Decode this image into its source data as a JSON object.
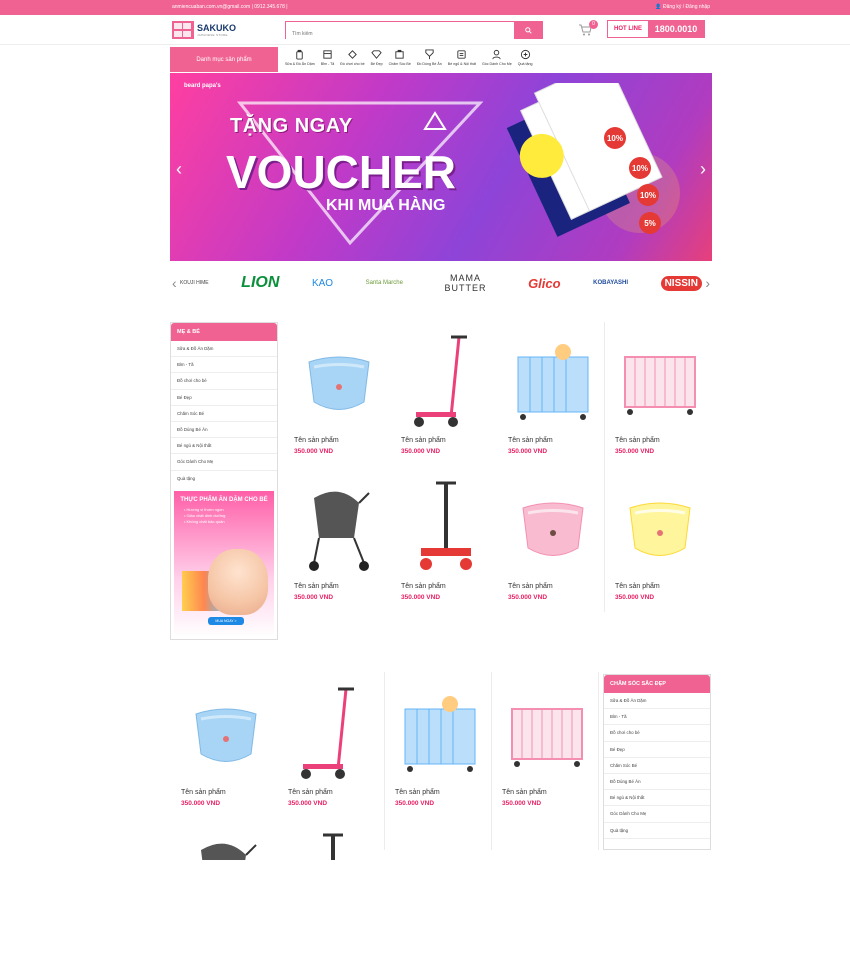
{
  "topbar": {
    "email": "anmiencuaban.com.vn@gmail.com",
    "phone": "0912.345.678",
    "auth": "Đăng ký / Đăng nhập"
  },
  "logo": {
    "brand": "SAKUKO",
    "sub": "JAPANESE STORE"
  },
  "search": {
    "placeholder": "Tìm kiếm"
  },
  "cart": {
    "count": "0"
  },
  "hotline": {
    "label": "HOT LINE",
    "number": "1800.0010"
  },
  "nav": {
    "category_label": "Danh mục sản phẩm",
    "items": [
      {
        "label": "Sữa & Đồ Ăn Dặm",
        "icon": "bottle-icon"
      },
      {
        "label": "Bỉm - Tã",
        "icon": "diaper-icon"
      },
      {
        "label": "Đồ chơi cho bé",
        "icon": "toy-icon"
      },
      {
        "label": "Bé Đẹp",
        "icon": "diamond-icon"
      },
      {
        "label": "Chăm Sóc Bé",
        "icon": "care-icon"
      },
      {
        "label": "Đồ Dùng Bé Ăn",
        "icon": "dish-icon"
      },
      {
        "label": "Bé ngủ & Nội thất",
        "icon": "bed-icon"
      },
      {
        "label": "Góc Dành Cho Mẹ",
        "icon": "mom-icon"
      },
      {
        "label": "Quà tặng",
        "icon": "gift-icon"
      }
    ]
  },
  "banner": {
    "brand": "beard papa's",
    "line1": "TẶNG NGAY",
    "line2": "VOUCHER",
    "line3": "KHI MUA HÀNG",
    "vouchers": [
      "10%",
      "10%",
      "10%",
      "5%"
    ]
  },
  "brands": [
    "KOUJI HIME",
    "LION",
    "KAO",
    "Santa Marche",
    "MAMA BUTTER",
    "Glico",
    "KOBAYASHI",
    "NISSIN"
  ],
  "section1": {
    "title": "MẸ & BÉ",
    "items": [
      "Sữa & Đồ Ăn Dặm",
      "Bỉm - Tã",
      "Đồ chơi cho bé",
      "Bé Đẹp",
      "Chăm Sóc Bé",
      "Đồ Dùng Bé Ăn",
      "Bé ngủ & Nội thất",
      "Góc Dành Cho Mẹ",
      "Quà tặng"
    ],
    "promo": {
      "title": "THỰC PHẨM ĂN DẶM CHO BÉ",
      "bullets": [
        "• Hương vị thơm ngon",
        "• Giàu chất dinh dưỡng",
        "• Không chất bảo quản"
      ],
      "button": "MUA NGAY >"
    }
  },
  "section2": {
    "title": "CHĂM SÓC SẮC ĐẸP",
    "items": [
      "Sữa & Đồ Ăn Dặm",
      "Bỉm - Tã",
      "Đồ chơi cho bé",
      "Bé Đẹp",
      "Chăm Sóc Bé",
      "Đồ Dùng Bé Ăn",
      "Bé ngủ & Nội thất",
      "Góc Dành Cho Mẹ",
      "Quà tặng"
    ]
  },
  "product": {
    "name": "Tên sản phẩm",
    "price": "350.000 VND"
  },
  "colors": {
    "pink": "#f06292",
    "price": "#e91e63"
  }
}
